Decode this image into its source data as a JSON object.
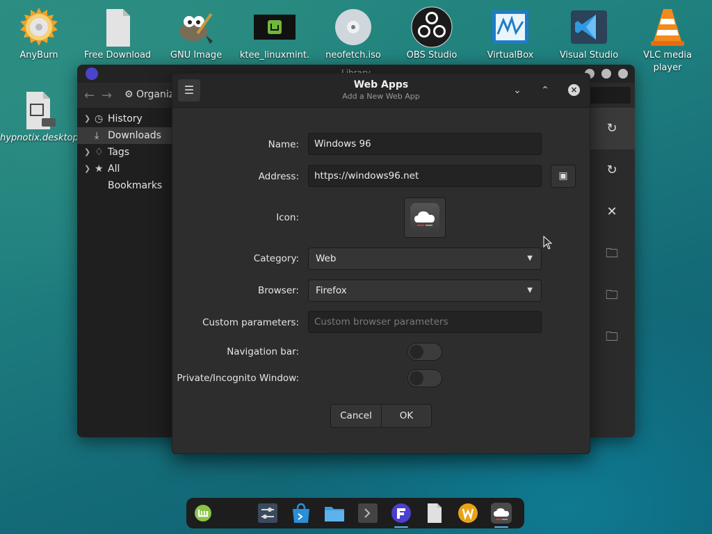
{
  "desktop": {
    "icons": [
      {
        "label": "AnyBurn",
        "icon": "disc-burn-icon"
      },
      {
        "label": "Free Download",
        "icon": "document-icon"
      },
      {
        "label": "GNU Image",
        "icon": "gimp-icon"
      },
      {
        "label": "ktee_linuxmint.",
        "icon": "mint-image-icon"
      },
      {
        "label": "neofetch.iso",
        "icon": "disc-image-icon"
      },
      {
        "label": "OBS Studio",
        "icon": "obs-icon"
      },
      {
        "label": "VirtualBox",
        "icon": "virtualbox-icon"
      },
      {
        "label": "Visual Studio",
        "icon": "vscode-icon"
      },
      {
        "label": "VLC media player",
        "icon": "vlc-icon"
      },
      {
        "label": "hypnotix.desktop",
        "icon": "desktop-file-icon"
      }
    ]
  },
  "library": {
    "title": "Library",
    "toolbar": {
      "organize": "Organiz"
    },
    "tree": [
      {
        "label": "History",
        "icon": "clock-icon",
        "has_children": true
      },
      {
        "label": "Downloads",
        "icon": "download-icon",
        "has_children": false
      },
      {
        "label": "Tags",
        "icon": "tag-icon",
        "has_children": true
      },
      {
        "label": "All Bookmarks",
        "icon": "star-icon",
        "has_children": true
      }
    ]
  },
  "dialog": {
    "title": "Web Apps",
    "subtitle": "Add a New Web App",
    "fields": {
      "name_label": "Name:",
      "name_value": "Windows 96",
      "address_label": "Address:",
      "address_value": "https://windows96.net",
      "icon_label": "Icon:",
      "category_label": "Category:",
      "category_value": "Web",
      "browser_label": "Browser:",
      "browser_value": "Firefox",
      "custom_label": "Custom parameters:",
      "custom_placeholder": "Custom browser parameters",
      "navbar_label": "Navigation bar:",
      "navbar_on": false,
      "private_label": "Private/Incognito Window:",
      "private_on": false
    },
    "buttons": {
      "cancel": "Cancel",
      "ok": "OK"
    }
  },
  "taskbar": {
    "items": [
      {
        "icon": "mint-menu-icon"
      },
      {
        "icon": "settings-sliders-icon"
      },
      {
        "icon": "software-store-icon"
      },
      {
        "icon": "files-folder-icon"
      },
      {
        "icon": "terminal-icon"
      },
      {
        "icon": "firefox-icon"
      },
      {
        "icon": "text-file-icon"
      },
      {
        "icon": "warpinator-icon"
      },
      {
        "icon": "webapps-icon",
        "active": true
      }
    ]
  },
  "colors": {
    "accent": "#5fb8e6",
    "dialog_bg": "#2d2d2d"
  }
}
